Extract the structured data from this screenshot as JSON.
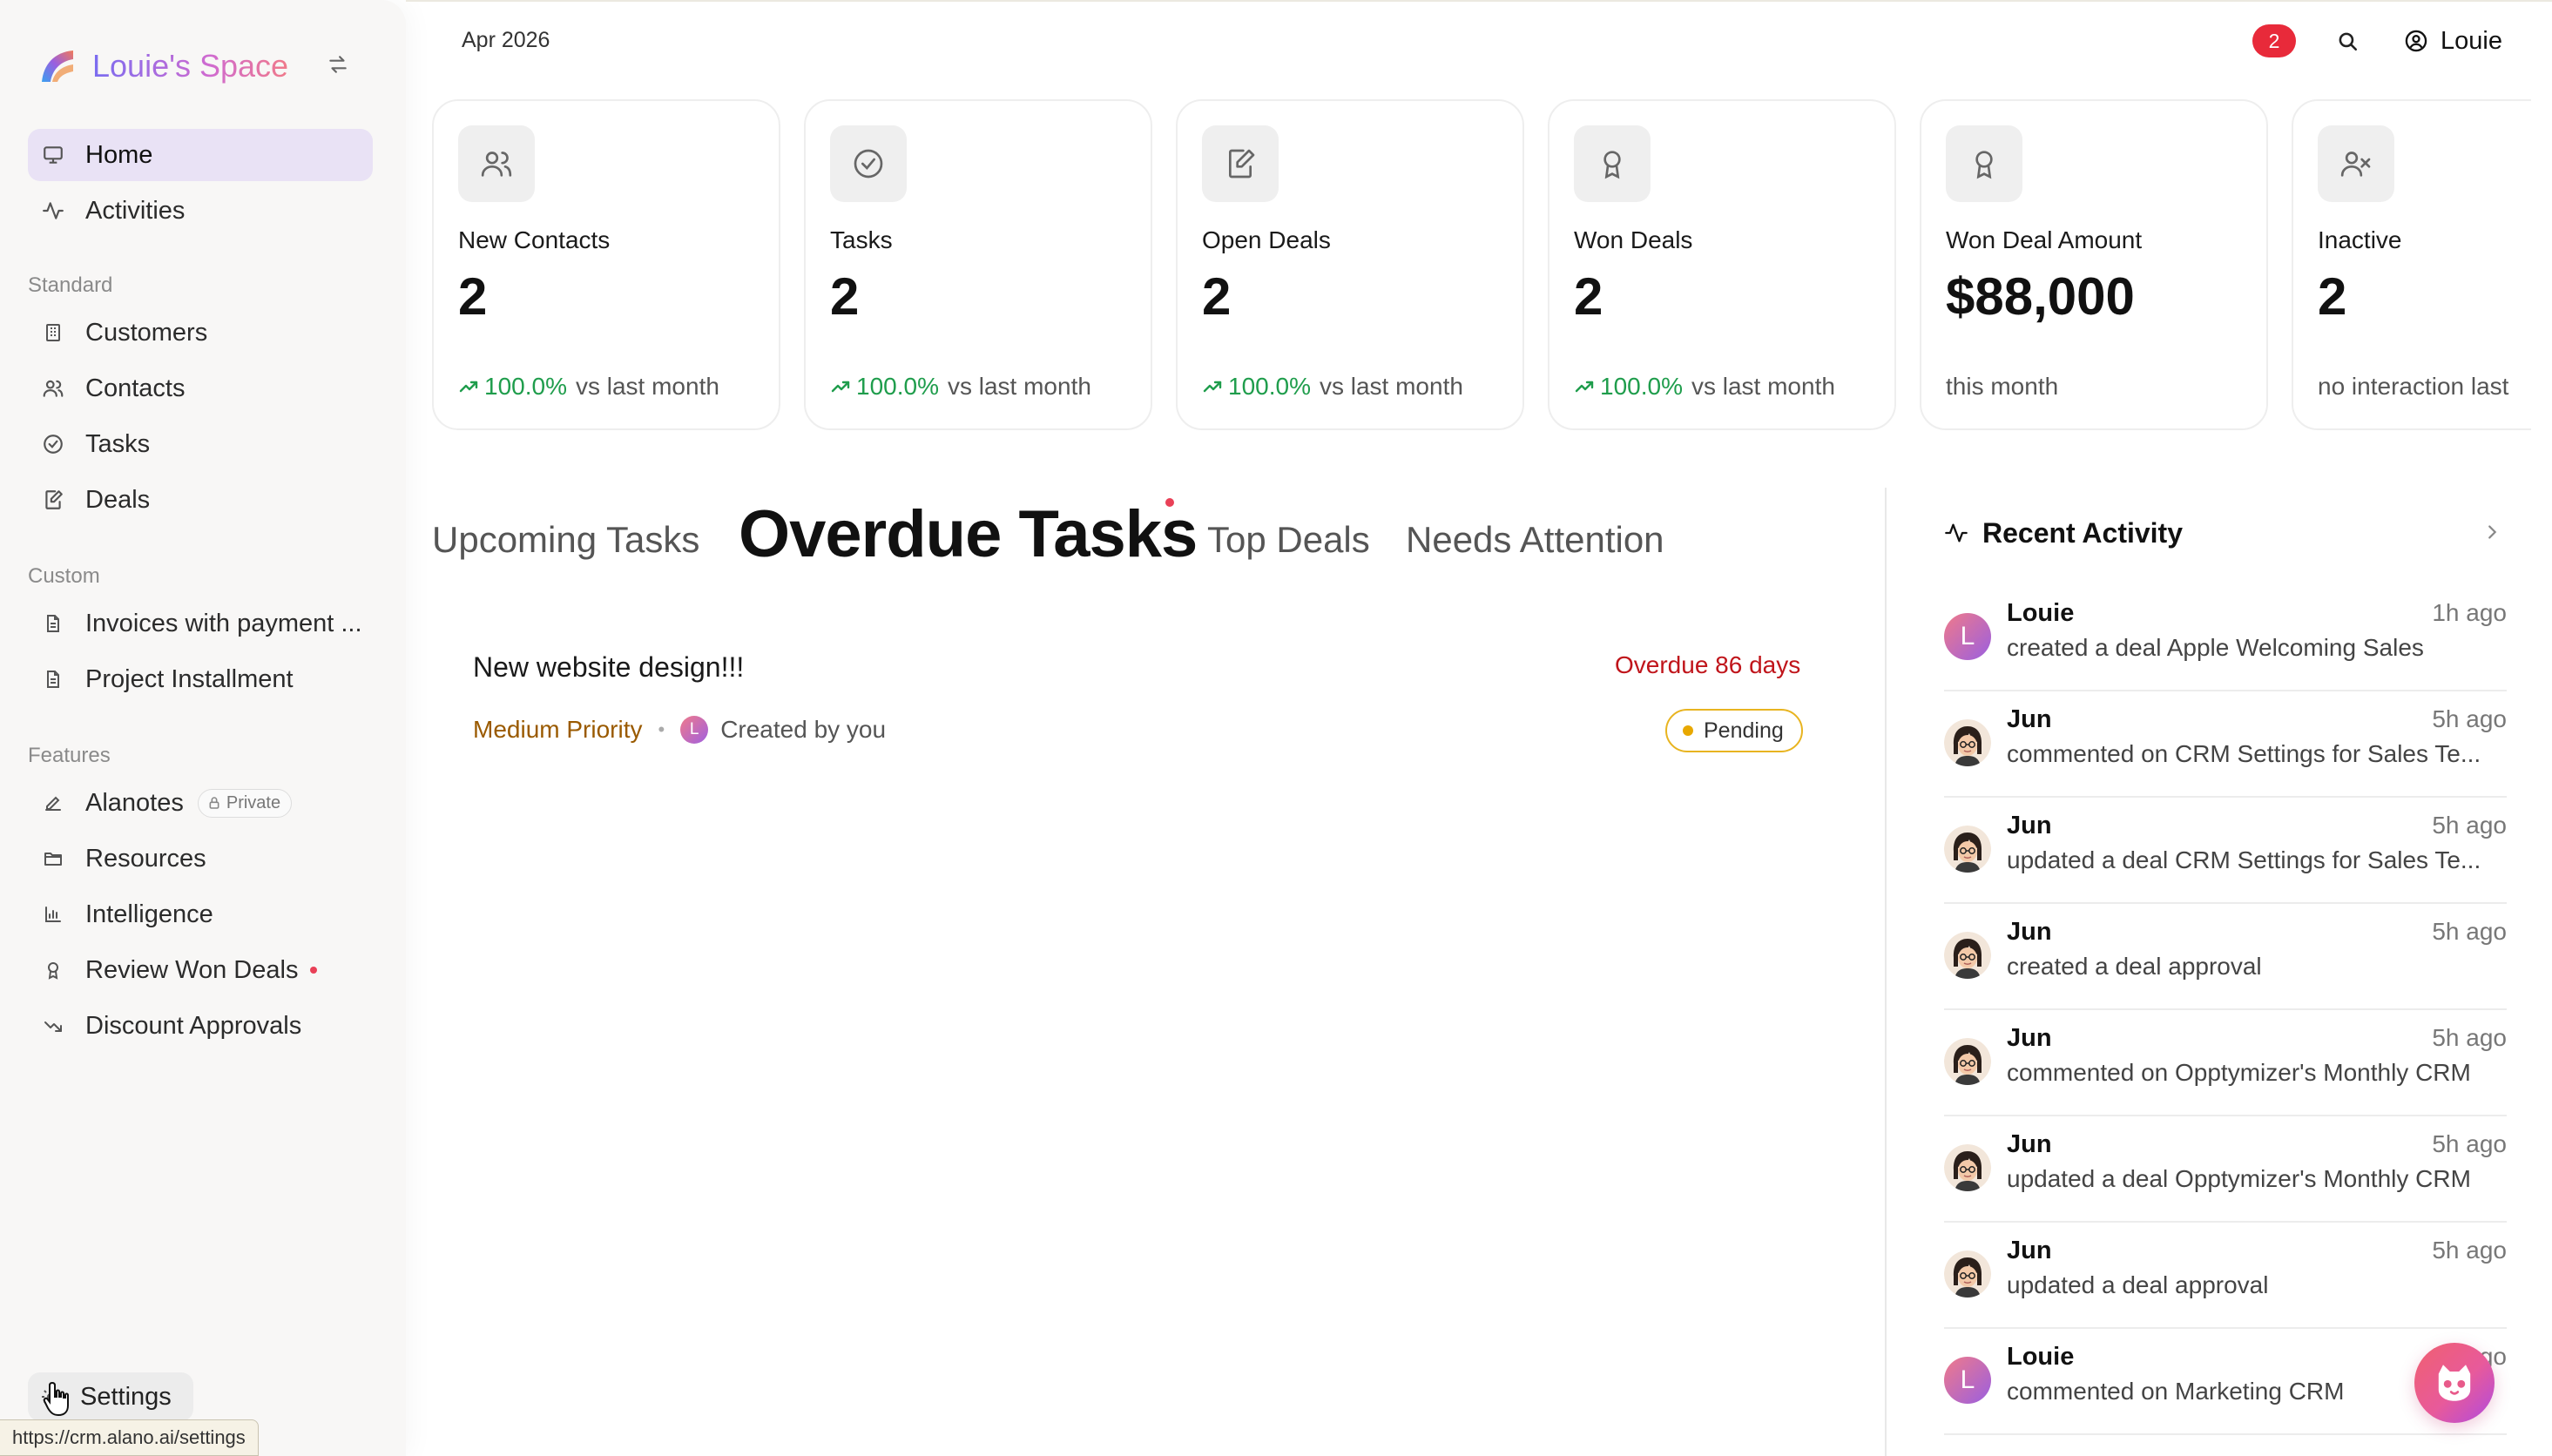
{
  "brand": {
    "name": "Louie's Space"
  },
  "sidebar": {
    "top_items": [
      {
        "label": "Home",
        "icon": "monitor-icon"
      },
      {
        "label": "Activities",
        "icon": "activity-icon"
      }
    ],
    "standard_label": "Standard",
    "standard_items": [
      {
        "label": "Customers",
        "icon": "building-icon"
      },
      {
        "label": "Contacts",
        "icon": "users-icon"
      },
      {
        "label": "Tasks",
        "icon": "check-circle-icon"
      },
      {
        "label": "Deals",
        "icon": "edit-document-icon"
      }
    ],
    "custom_label": "Custom",
    "custom_items": [
      {
        "label": "Invoices with payment ...",
        "icon": "document-icon"
      },
      {
        "label": "Project Installment",
        "icon": "document-icon"
      }
    ],
    "features_label": "Features",
    "features_items": [
      {
        "label": "Alanotes",
        "icon": "pen-icon",
        "badge": "Private"
      },
      {
        "label": "Resources",
        "icon": "folder-icon"
      },
      {
        "label": "Intelligence",
        "icon": "bar-chart-icon"
      },
      {
        "label": "Review Won Deals",
        "icon": "award-icon"
      },
      {
        "label": "Discount Approvals",
        "icon": "trending-down-icon"
      }
    ],
    "settings_label": "Settings",
    "hover_url": "https://crm.alano.ai/settings"
  },
  "header": {
    "date": "Apr 2026",
    "notification_count": "2",
    "user_name": "Louie"
  },
  "cards": [
    {
      "label": "New Contacts",
      "value": "2",
      "trend": "100.0%",
      "suffix": "vs last month",
      "icon": "users-icon"
    },
    {
      "label": "Tasks",
      "value": "2",
      "trend": "100.0%",
      "suffix": "vs last month",
      "icon": "check-circle-icon"
    },
    {
      "label": "Open Deals",
      "value": "2",
      "trend": "100.0%",
      "suffix": "vs last month",
      "icon": "edit-document-icon"
    },
    {
      "label": "Won Deals",
      "value": "2",
      "trend": "100.0%",
      "suffix": "vs last month",
      "icon": "award-icon"
    },
    {
      "label": "Won Deal Amount",
      "value": "$88,000",
      "suffix": "this month",
      "icon": "award-icon"
    },
    {
      "label": "Inactive",
      "value": "2",
      "suffix": "no interaction last",
      "icon": "user-x-icon"
    }
  ],
  "tabs": [
    {
      "label": "Upcoming Tasks"
    },
    {
      "label": "Overdue Tasks"
    },
    {
      "label": "Top Deals"
    },
    {
      "label": "Needs Attention"
    }
  ],
  "task": {
    "title": "New website design!!!",
    "overdue": "Overdue 86 days",
    "priority": "Medium Priority",
    "avatar_letter": "L",
    "creator": "Created by you",
    "status": "Pending"
  },
  "recent_activity": {
    "title": "Recent Activity",
    "items": [
      {
        "name": "Louie",
        "time": "1h ago",
        "desc": "created a deal Apple Welcoming Sales",
        "avatar": "letter",
        "letter": "L"
      },
      {
        "name": "Jun",
        "time": "5h ago",
        "desc": "commented on CRM Settings for Sales Te...",
        "avatar": "photo"
      },
      {
        "name": "Jun",
        "time": "5h ago",
        "desc": "updated a deal CRM Settings for Sales Te...",
        "avatar": "photo"
      },
      {
        "name": "Jun",
        "time": "5h ago",
        "desc": "created a deal approval",
        "avatar": "photo"
      },
      {
        "name": "Jun",
        "time": "5h ago",
        "desc": "commented on Opptymizer's Monthly CRM",
        "avatar": "photo"
      },
      {
        "name": "Jun",
        "time": "5h ago",
        "desc": "updated a deal Opptymizer's Monthly CRM",
        "avatar": "photo"
      },
      {
        "name": "Jun",
        "time": "5h ago",
        "desc": "updated a deal approval",
        "avatar": "photo"
      },
      {
        "name": "Louie",
        "time": "5h ago",
        "desc": "commented on Marketing CRM",
        "avatar": "letter",
        "letter": "L"
      }
    ]
  },
  "colors": {
    "accent": "#e9e2f5",
    "trend_up": "#1f9d4c",
    "overdue": "#c0151b",
    "priority": "#9a5a00",
    "badge_red": "#e82a3a"
  }
}
